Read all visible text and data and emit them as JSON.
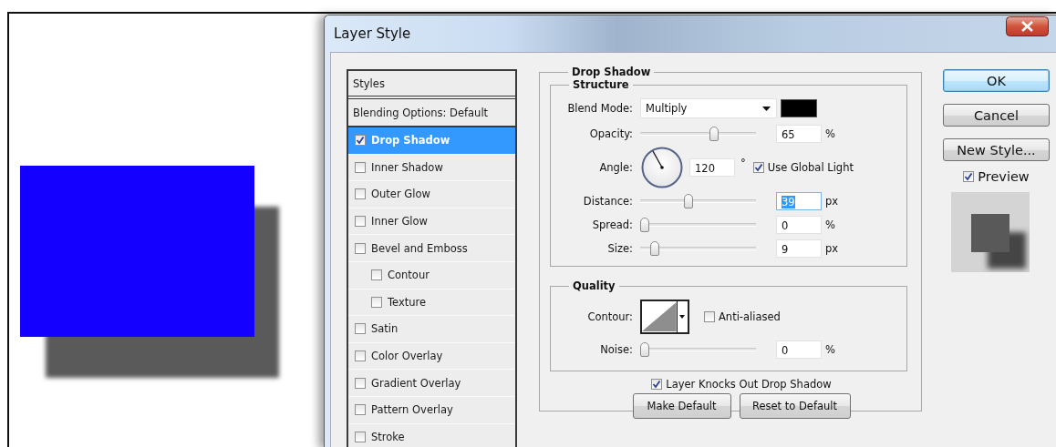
{
  "window": {
    "title": "Layer Style"
  },
  "styles_list": {
    "header": "Styles",
    "items": [
      {
        "label": "Blending Options: Default",
        "kind": "plain",
        "selected": false
      },
      {
        "label": "Drop Shadow",
        "kind": "check",
        "checked": true,
        "selected": true
      },
      {
        "label": "Inner Shadow",
        "kind": "check",
        "checked": false,
        "selected": false
      },
      {
        "label": "Outer Glow",
        "kind": "check",
        "checked": false,
        "selected": false
      },
      {
        "label": "Inner Glow",
        "kind": "check",
        "checked": false,
        "selected": false
      },
      {
        "label": "Bevel and Emboss",
        "kind": "check",
        "checked": false,
        "selected": false,
        "children": [
          {
            "label": "Contour",
            "kind": "check",
            "checked": false,
            "selected": false
          },
          {
            "label": "Texture",
            "kind": "check",
            "checked": false,
            "selected": false
          }
        ]
      },
      {
        "label": "Satin",
        "kind": "check",
        "checked": false,
        "selected": false
      },
      {
        "label": "Color Overlay",
        "kind": "check",
        "checked": false,
        "selected": false
      },
      {
        "label": "Gradient Overlay",
        "kind": "check",
        "checked": false,
        "selected": false
      },
      {
        "label": "Pattern Overlay",
        "kind": "check",
        "checked": false,
        "selected": false
      },
      {
        "label": "Stroke",
        "kind": "check",
        "checked": false,
        "selected": false
      }
    ]
  },
  "drop_shadow": {
    "title": "Drop Shadow",
    "structure": {
      "title": "Structure",
      "blend_mode": {
        "label": "Blend Mode:",
        "value": "Multiply"
      },
      "opacity": {
        "label": "Opacity:",
        "level": 0.65,
        "value": "65",
        "unit": "%"
      },
      "angle": {
        "label": "Angle:",
        "value": "120",
        "unit": "°",
        "global_light": {
          "label": "Use Global Light",
          "checked": true
        }
      },
      "distance": {
        "label": "Distance:",
        "level": 0.41,
        "value": "39",
        "unit": "px",
        "text_selected": true
      },
      "spread": {
        "label": "Spread:",
        "level": 0,
        "value": "0",
        "unit": "%"
      },
      "size": {
        "label": "Size:",
        "level": 0.09,
        "value": "9",
        "unit": "px"
      }
    },
    "quality": {
      "title": "Quality",
      "contour": {
        "label": "Contour:"
      },
      "anti_aliased": {
        "label": "Anti-aliased",
        "checked": false
      },
      "noise": {
        "label": "Noise:",
        "level": 0,
        "value": "0",
        "unit": "%"
      }
    },
    "knockout": {
      "label": "Layer Knocks Out Drop Shadow",
      "checked": true
    },
    "buttons": [
      "Make Default",
      "Reset to Default"
    ]
  },
  "side": {
    "buttons": [
      {
        "label": "OK",
        "default": true
      },
      {
        "label": "Cancel",
        "default": false
      },
      {
        "label": "New Style...",
        "default": false
      }
    ],
    "preview": {
      "label": "Preview",
      "checked": true
    }
  }
}
